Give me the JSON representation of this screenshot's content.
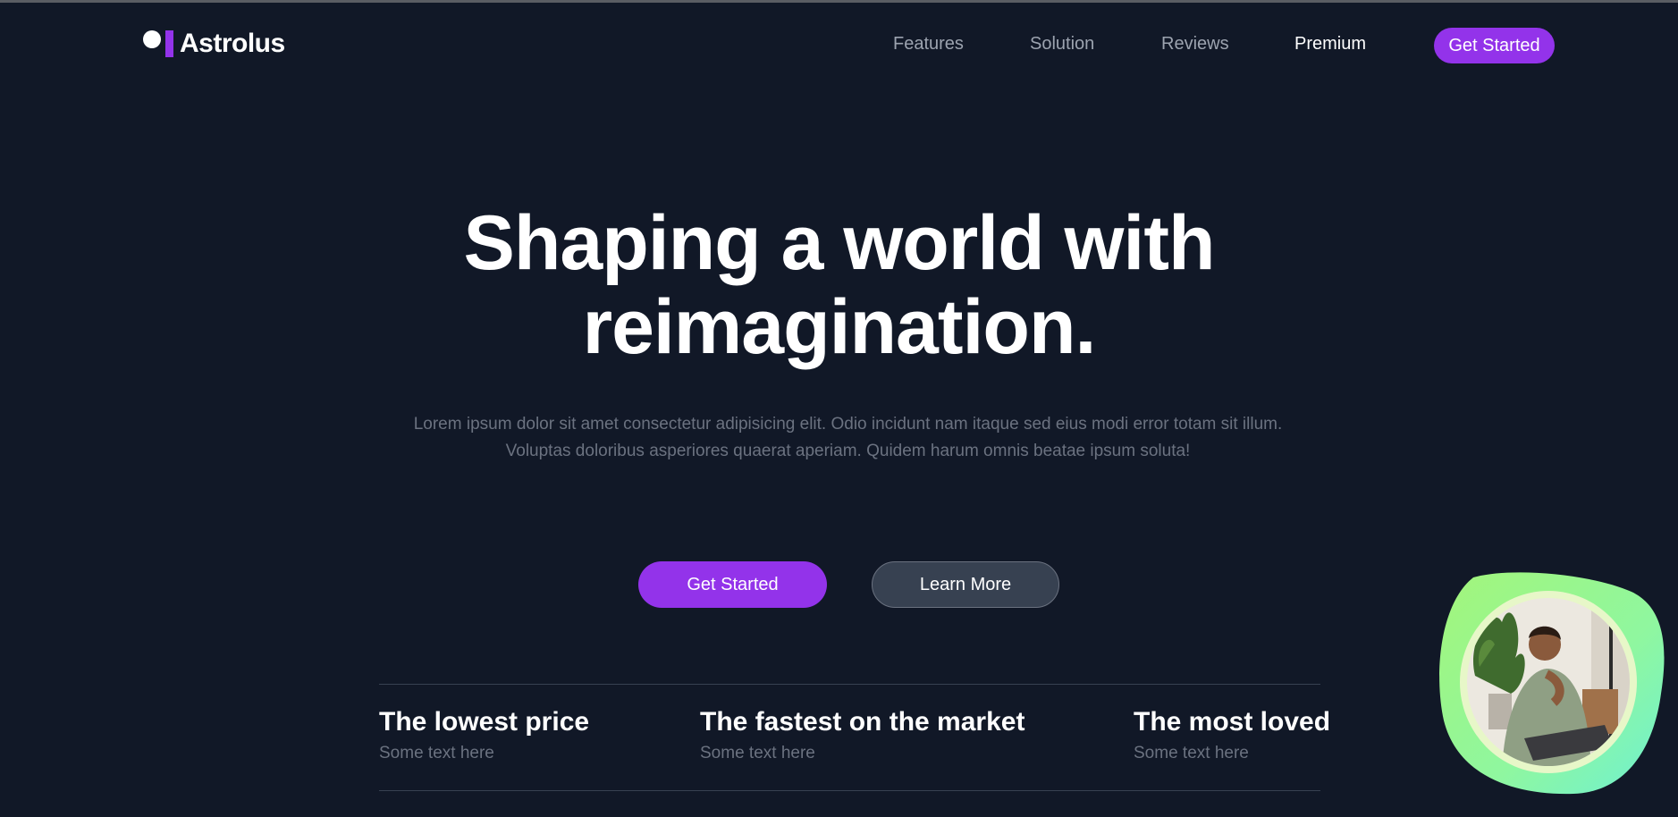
{
  "brand": {
    "name": "Astrolus",
    "accent": "#9333ea",
    "background": "#111827"
  },
  "nav": {
    "links": [
      {
        "label": "Features"
      },
      {
        "label": "Solution"
      },
      {
        "label": "Reviews"
      },
      {
        "label": "Premium"
      }
    ],
    "cta_label": "Get Started"
  },
  "hero": {
    "title_line1": "Shaping a world with",
    "title_line2": "reimagination.",
    "subtitle_line1": "Lorem ipsum dolor sit amet consectetur adipisicing elit. Odio incidunt nam itaque sed eius modi error totam sit illum.",
    "subtitle_line2": "Voluptas doloribus asperiores quaerat aperiam. Quidem harum omnis beatae ipsum soluta!",
    "primary_button": "Get Started",
    "secondary_button": "Learn More"
  },
  "features": [
    {
      "title": "The lowest price",
      "text": "Some text here"
    },
    {
      "title": "The fastest on the market",
      "text": "Some text here"
    },
    {
      "title": "The most loved",
      "text": "Some text here"
    }
  ],
  "video_bubble": {
    "icon": "person-video-icon"
  }
}
